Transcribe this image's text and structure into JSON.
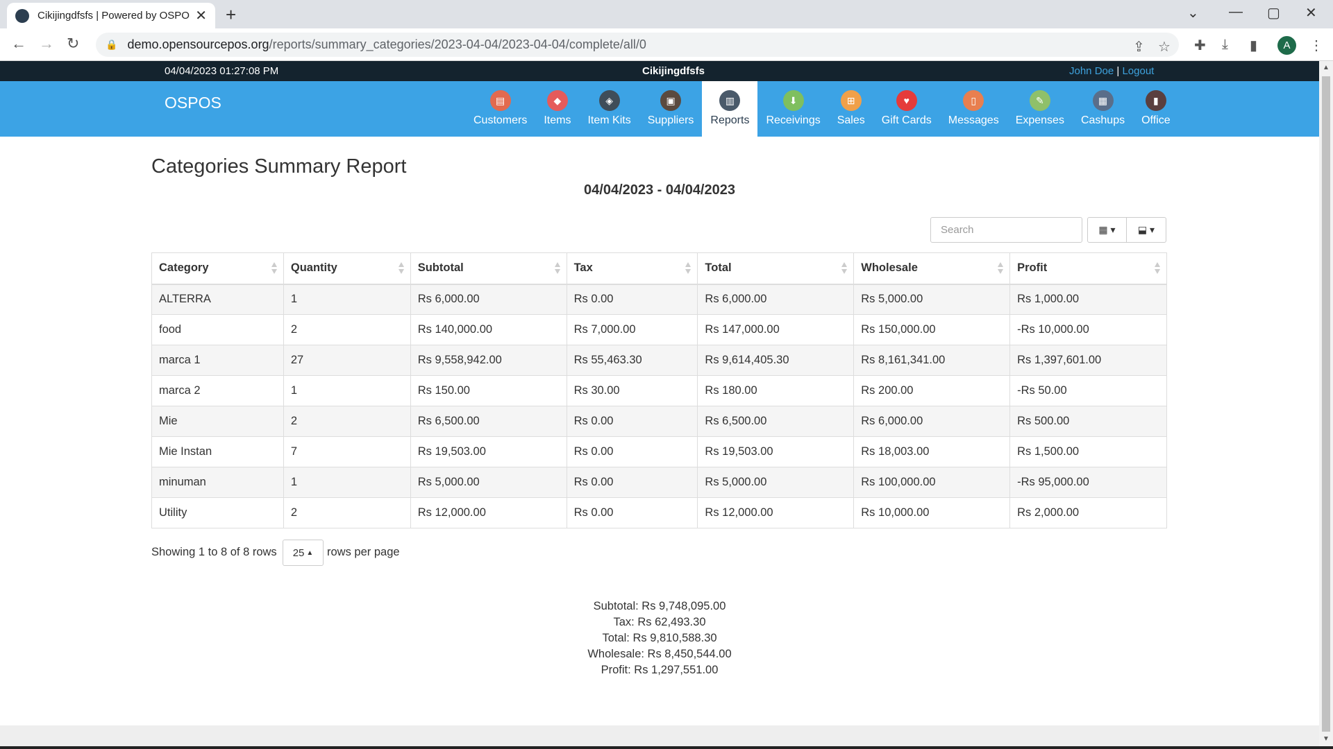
{
  "browser": {
    "tab_title": "Cikijingdfsfs | Powered by OSPOS",
    "url_host": "demo.opensourcepos.org",
    "url_path": "/reports/summary_categories/2023-04-04/2023-04-04/complete/all/0",
    "profile_initial": "A"
  },
  "topbar": {
    "datetime": "04/04/2023 01:27:08 PM",
    "company": "Cikijingdfsfs",
    "user_name": "John Doe",
    "separator": "|",
    "logout": "Logout"
  },
  "navbar": {
    "brand": "OSPOS",
    "items": [
      {
        "label": "Customers",
        "color": "#e26a4f",
        "icon": "customers-icon"
      },
      {
        "label": "Items",
        "color": "#e55b5b",
        "icon": "items-icon"
      },
      {
        "label": "Item Kits",
        "color": "#3f4d59",
        "icon": "item-kits-icon"
      },
      {
        "label": "Suppliers",
        "color": "#5a4a3f",
        "icon": "suppliers-icon"
      },
      {
        "label": "Reports",
        "color": "#4a5a6a",
        "icon": "reports-icon"
      },
      {
        "label": "Receivings",
        "color": "#7fbf5f",
        "icon": "receivings-icon"
      },
      {
        "label": "Sales",
        "color": "#f0a04a",
        "icon": "sales-icon"
      },
      {
        "label": "Gift Cards",
        "color": "#e53b3b",
        "icon": "gift-cards-icon"
      },
      {
        "label": "Messages",
        "color": "#e87f4f",
        "icon": "messages-icon"
      },
      {
        "label": "Expenses",
        "color": "#8fc06a",
        "icon": "expenses-icon"
      },
      {
        "label": "Cashups",
        "color": "#5a6e8a",
        "icon": "cashups-icon"
      },
      {
        "label": "Office",
        "color": "#5a3f3f",
        "icon": "office-icon"
      }
    ],
    "active": "Reports"
  },
  "report": {
    "title": "Categories Summary Report",
    "date_range": "04/04/2023 - 04/04/2023",
    "search_placeholder": "Search",
    "columns": [
      "Category",
      "Quantity",
      "Subtotal",
      "Tax",
      "Total",
      "Wholesale",
      "Profit"
    ],
    "rows": [
      [
        "ALTERRA",
        "1",
        "Rs 6,000.00",
        "Rs 0.00",
        "Rs 6,000.00",
        "Rs 5,000.00",
        "Rs 1,000.00"
      ],
      [
        "food",
        "2",
        "Rs 140,000.00",
        "Rs 7,000.00",
        "Rs 147,000.00",
        "Rs 150,000.00",
        "-Rs 10,000.00"
      ],
      [
        "marca 1",
        "27",
        "Rs 9,558,942.00",
        "Rs 55,463.30",
        "Rs 9,614,405.30",
        "Rs 8,161,341.00",
        "Rs 1,397,601.00"
      ],
      [
        "marca 2",
        "1",
        "Rs 150.00",
        "Rs 30.00",
        "Rs 180.00",
        "Rs 200.00",
        "-Rs 50.00"
      ],
      [
        "Mie",
        "2",
        "Rs 6,500.00",
        "Rs 0.00",
        "Rs 6,500.00",
        "Rs 6,000.00",
        "Rs 500.00"
      ],
      [
        "Mie Instan",
        "7",
        "Rs 19,503.00",
        "Rs 0.00",
        "Rs 19,503.00",
        "Rs 18,003.00",
        "Rs 1,500.00"
      ],
      [
        "minuman",
        "1",
        "Rs 5,000.00",
        "Rs 0.00",
        "Rs 5,000.00",
        "Rs 100,000.00",
        "-Rs 95,000.00"
      ],
      [
        "Utility",
        "2",
        "Rs 12,000.00",
        "Rs 0.00",
        "Rs 12,000.00",
        "Rs 10,000.00",
        "Rs 2,000.00"
      ]
    ],
    "pagination": {
      "showing": "Showing 1 to 8 of 8 rows",
      "page_size": "25",
      "rows_per_page": "rows per page"
    },
    "summary": [
      "Subtotal: Rs 9,748,095.00",
      "Tax: Rs 62,493.30",
      "Total: Rs 9,810,588.30",
      "Wholesale: Rs 8,450,544.00",
      "Profit: Rs 1,297,551.00"
    ]
  }
}
